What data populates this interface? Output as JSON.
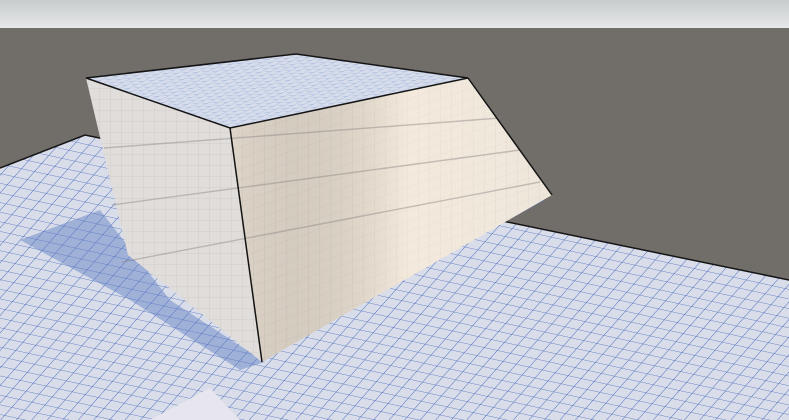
{
  "viewport": {
    "colors": {
      "sky_top": "#c7cbcc",
      "sky_bottom": "#e6e8e8",
      "void": "#716e6a",
      "floor_base": "#d8dde9",
      "floor_grid_fine": "#5b7fd0",
      "floor_grid_major": "#3558b8",
      "shadow": "#5e7cc4",
      "box_light": "#ece9e6",
      "box_shade": "#dcd8d6",
      "box_top": "#d6dcea",
      "ramp_lit": "#ede3d6",
      "edge": "#141414"
    }
  }
}
